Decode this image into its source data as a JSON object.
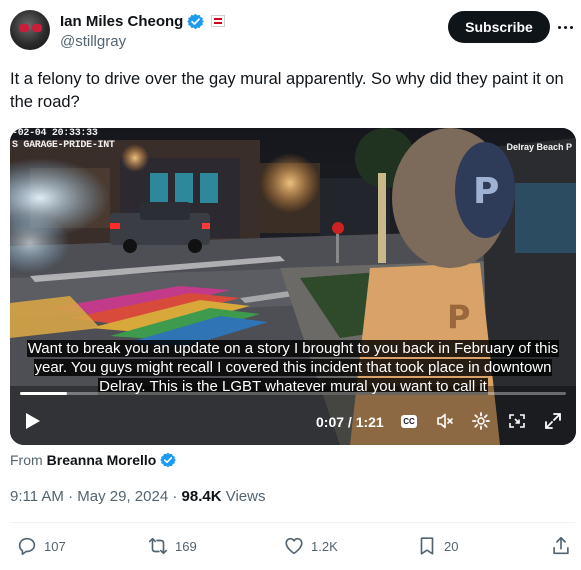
{
  "author": {
    "display_name": "Ian Miles Cheong",
    "handle": "@stillgray",
    "subscribe_label": "Subscribe"
  },
  "tweet": {
    "text": "It a felony to drive over the gay mural apparently. So why did they paint it on the road?"
  },
  "video": {
    "overlay_timestamp": "-02-04 20:33:33",
    "overlay_camera": "S GARAGE-PRIDE-INT",
    "overlay_location": "Delray Beach P",
    "caption": "Want to break you an update on a story I brought to you back in February of this year. You guys might recall I covered this incident that took place in downtown Delray. This is the LGBT whatever mural you want to call it",
    "time_display": "0:07 / 1:21",
    "cc_label": "CC",
    "progress_fraction": 0.086
  },
  "source": {
    "prefix": "From",
    "name": "Breanna Morello"
  },
  "meta": {
    "time": "9:11 AM",
    "sep": "·",
    "date": "May 29, 2024",
    "views_count": "98.4K",
    "views_label": "Views"
  },
  "actions": {
    "replies": "107",
    "reposts": "169",
    "likes": "1.2K",
    "bookmarks": "20"
  },
  "colors": {
    "accent_verified": "#1d9bf0",
    "text_primary": "#0f1419",
    "text_secondary": "#536471",
    "subscribe_bg": "#0f1419"
  }
}
